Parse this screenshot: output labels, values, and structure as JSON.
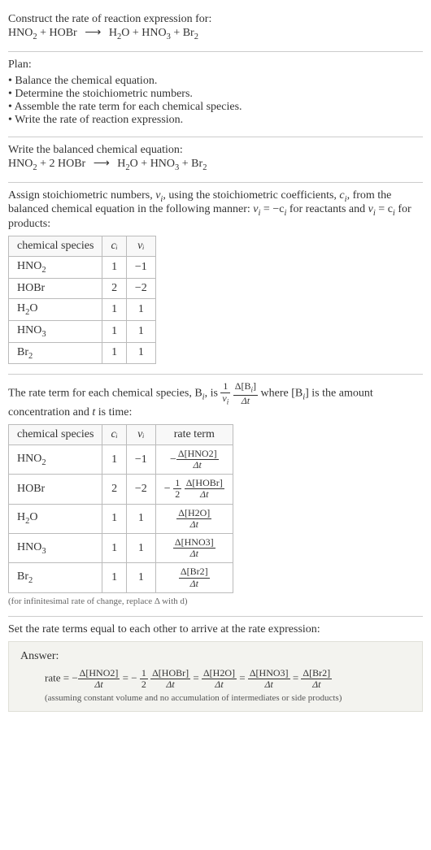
{
  "intro": {
    "line1": "Construct the rate of reaction expression for:",
    "eq_left1": "HNO",
    "eq_left1_sub": "2",
    "plus1": " + ",
    "eq_left2": "HOBr",
    "arrow": "⟶",
    "eq_r1": "H",
    "eq_r1_sub": "2",
    "eq_r1b": "O",
    "plus2": " + ",
    "eq_r2": "HNO",
    "eq_r2_sub": "3",
    "plus3": " + ",
    "eq_r3": "Br",
    "eq_r3_sub": "2"
  },
  "plan": {
    "title": "Plan:",
    "items": [
      "Balance the chemical equation.",
      "Determine the stoichiometric numbers.",
      "Assemble the rate term for each chemical species.",
      "Write the rate of reaction expression."
    ]
  },
  "balanced": {
    "title": "Write the balanced chemical equation:",
    "l1": "HNO",
    "l1s": "2",
    "plus1": " + 2 HOBr",
    "arrow": "⟶",
    "r1": "H",
    "r1s": "2",
    "r1b": "O",
    "plus2": " + HNO",
    "r2s": "3",
    "plus3": " + Br",
    "r3s": "2"
  },
  "stoich": {
    "intro_a": "Assign stoichiometric numbers, ",
    "nu_i": "ν",
    "nu_i_sub": "i",
    "intro_b": ", using the stoichiometric coefficients, ",
    "c_i": "c",
    "c_i_sub": "i",
    "intro_c": ", from the balanced chemical equation in the following manner: ",
    "rel1a": "ν",
    "rel1a_sub": "i",
    "rel1b": " = −c",
    "rel1b_sub": "i",
    "intro_d": " for reactants and ",
    "rel2a": "ν",
    "rel2a_sub": "i",
    "rel2b": " = c",
    "rel2b_sub": "i",
    "intro_e": " for products:",
    "headers": [
      "chemical species",
      "cᵢ",
      "νᵢ"
    ],
    "rows": [
      {
        "sp": "HNO",
        "sp_sub": "2",
        "c": "1",
        "v": "−1"
      },
      {
        "sp": "HOBr",
        "sp_sub": "",
        "c": "2",
        "v": "−2"
      },
      {
        "sp": "H",
        "sp_sub": "2",
        "sp2": "O",
        "c": "1",
        "v": "1"
      },
      {
        "sp": "HNO",
        "sp_sub": "3",
        "c": "1",
        "v": "1"
      },
      {
        "sp": "Br",
        "sp_sub": "2",
        "c": "1",
        "v": "1"
      }
    ]
  },
  "rateterm": {
    "intro_a": "The rate term for each chemical species, B",
    "sub_i": "i",
    "intro_b": ", is ",
    "frac1_num": "1",
    "frac1_den_a": "ν",
    "frac1_den_sub": "i",
    "frac2_num_a": "Δ[B",
    "frac2_num_sub": "i",
    "frac2_num_b": "]",
    "frac2_den": "Δt",
    "intro_c": " where [B",
    "intro_c_sub": "i",
    "intro_d": "] is the amount concentration and ",
    "t": "t",
    "intro_e": " is time:",
    "headers": [
      "chemical species",
      "cᵢ",
      "νᵢ",
      "rate term"
    ],
    "rows": [
      {
        "sp": "HNO",
        "sp_sub": "2",
        "c": "1",
        "v": "−1",
        "sign": "−",
        "coef": "",
        "num": "Δ[HNO2]",
        "den": "Δt"
      },
      {
        "sp": "HOBr",
        "sp_sub": "",
        "c": "2",
        "v": "−2",
        "sign": "−",
        "coef_num": "1",
        "coef_den": "2",
        "num": "Δ[HOBr]",
        "den": "Δt"
      },
      {
        "sp": "H",
        "sp_sub": "2",
        "sp2": "O",
        "c": "1",
        "v": "1",
        "sign": "",
        "coef": "",
        "num": "Δ[H2O]",
        "den": "Δt"
      },
      {
        "sp": "HNO",
        "sp_sub": "3",
        "c": "1",
        "v": "1",
        "sign": "",
        "coef": "",
        "num": "Δ[HNO3]",
        "den": "Δt"
      },
      {
        "sp": "Br",
        "sp_sub": "2",
        "c": "1",
        "v": "1",
        "sign": "",
        "coef": "",
        "num": "Δ[Br2]",
        "den": "Δt"
      }
    ],
    "note": "(for infinitesimal rate of change, replace Δ with d)"
  },
  "final": {
    "title": "Set the rate terms equal to each other to arrive at the rate expression:",
    "answer_label": "Answer:",
    "rate_label": "rate = ",
    "terms": [
      {
        "sign": "−",
        "coef_num": "",
        "coef_den": "",
        "num": "Δ[HNO2]",
        "den": "Δt"
      },
      {
        "sign": "−",
        "coef_num": "1",
        "coef_den": "2",
        "num": "Δ[HOBr]",
        "den": "Δt"
      },
      {
        "sign": "",
        "coef_num": "",
        "coef_den": "",
        "num": "Δ[H2O]",
        "den": "Δt"
      },
      {
        "sign": "",
        "coef_num": "",
        "coef_den": "",
        "num": "Δ[HNO3]",
        "den": "Δt"
      },
      {
        "sign": "",
        "coef_num": "",
        "coef_den": "",
        "num": "Δ[Br2]",
        "den": "Δt"
      }
    ],
    "eq": " = ",
    "note": "(assuming constant volume and no accumulation of intermediates or side products)"
  }
}
